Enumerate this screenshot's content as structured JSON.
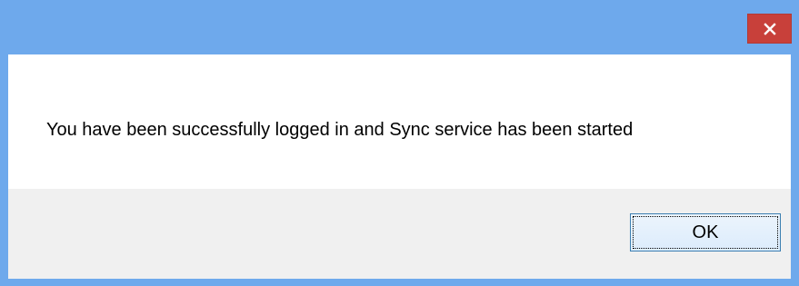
{
  "dialog": {
    "title": "",
    "close_icon": "close-icon",
    "message": "You have been successfully logged in and Sync service has been started",
    "ok_label": "OK"
  },
  "colors": {
    "titlebar": "#6ea9ec",
    "close_button": "#c8403a",
    "button_area": "#f0f0f0",
    "ok_border": "#3c7fb1"
  }
}
